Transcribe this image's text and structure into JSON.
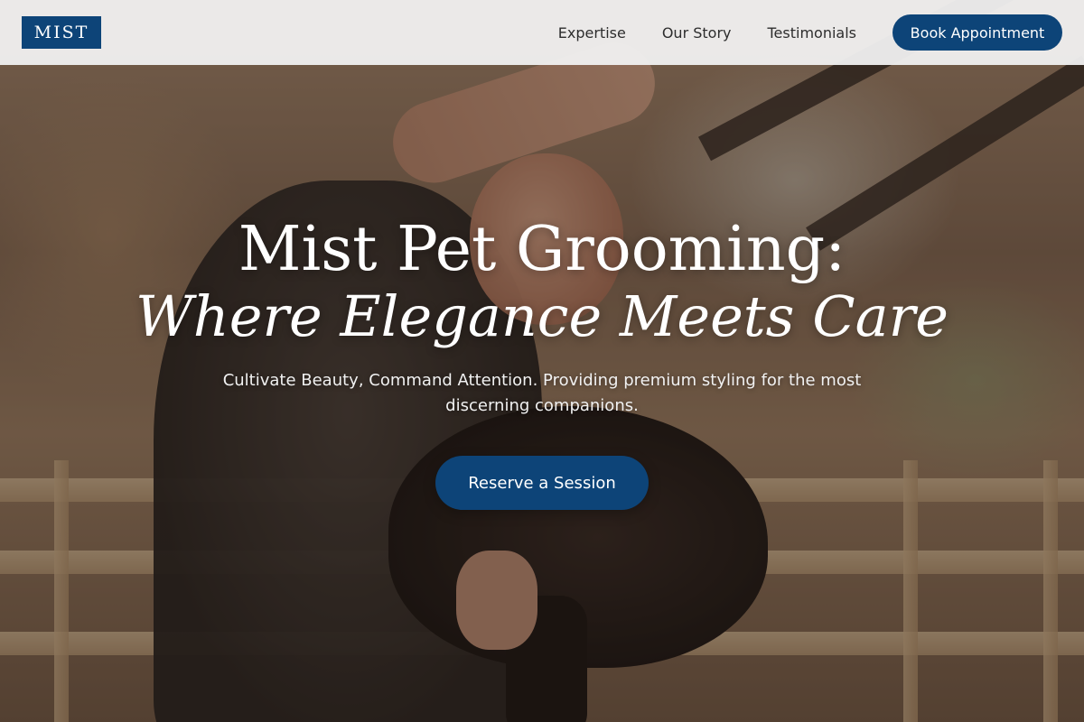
{
  "header": {
    "logo_text": "MIST",
    "nav": [
      {
        "label": "Expertise"
      },
      {
        "label": "Our Story"
      },
      {
        "label": "Testimonials"
      }
    ],
    "cta_label": "Book Appointment"
  },
  "hero": {
    "title_line1": "Mist Pet Grooming:",
    "title_line2": "Where Elegance Meets Care",
    "subtitle": "Cultivate Beauty, Command Attention. Providing premium styling for the most discerning companions.",
    "cta_label": "Reserve a Session"
  },
  "colors": {
    "brand_navy": "#0d4478",
    "header_bg": "#f2f2f2",
    "text_light": "#ffffff"
  }
}
